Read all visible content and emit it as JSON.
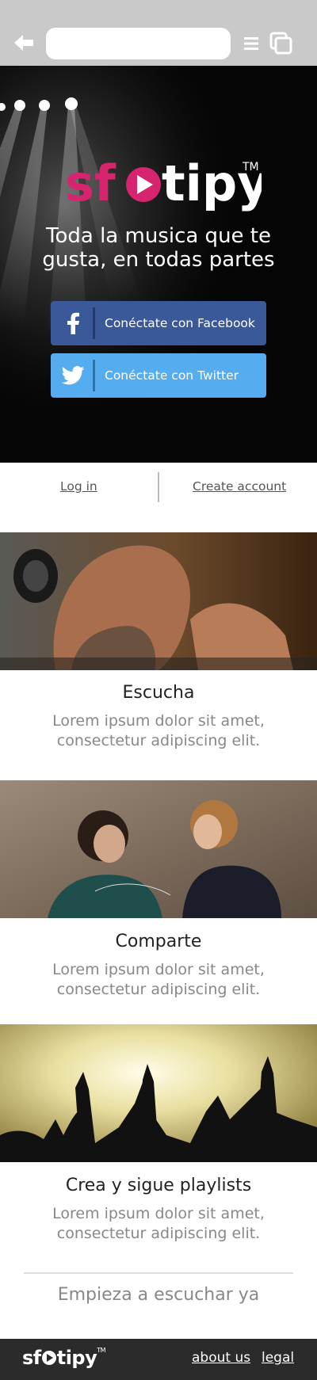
{
  "browser": {
    "url_value": "",
    "icons": [
      "back-arrow-icon",
      "hamburger-menu-icon",
      "tabs-icon"
    ]
  },
  "hero": {
    "brand_pre": "sf",
    "brand_post": "tipy",
    "trademark": "TM",
    "tagline_line1": "Toda la musica que te",
    "tagline_line2": "gusta, en todas partes",
    "facebook_label": "Conéctate con Facebook",
    "twitter_label": "Conéctate con Twitter",
    "colors": {
      "brand": "#d6246e",
      "facebook": "#3b5998",
      "twitter": "#55acee"
    }
  },
  "auth": {
    "login_label": "Log in",
    "create_label": "Create account"
  },
  "features": [
    {
      "title": "Escucha",
      "desc_line1": "Lorem ipsum dolor sit amet,",
      "desc_line2": "consectetur adipiscing elit."
    },
    {
      "title": "Comparte",
      "desc_line1": "Lorem ipsum dolor sit amet,",
      "desc_line2": "consectetur adipiscing elit."
    },
    {
      "title": "Crea y sigue playlists",
      "desc_line1": "Lorem ipsum dolor sit amet,",
      "desc_line2": "consectetur adipiscing elit."
    }
  ],
  "cta_label": "Empieza a escuchar ya",
  "footer": {
    "brand_pre": "sf",
    "brand_post": "tipy",
    "trademark": "TM",
    "about_label": "about us",
    "legal_label": "legal"
  }
}
